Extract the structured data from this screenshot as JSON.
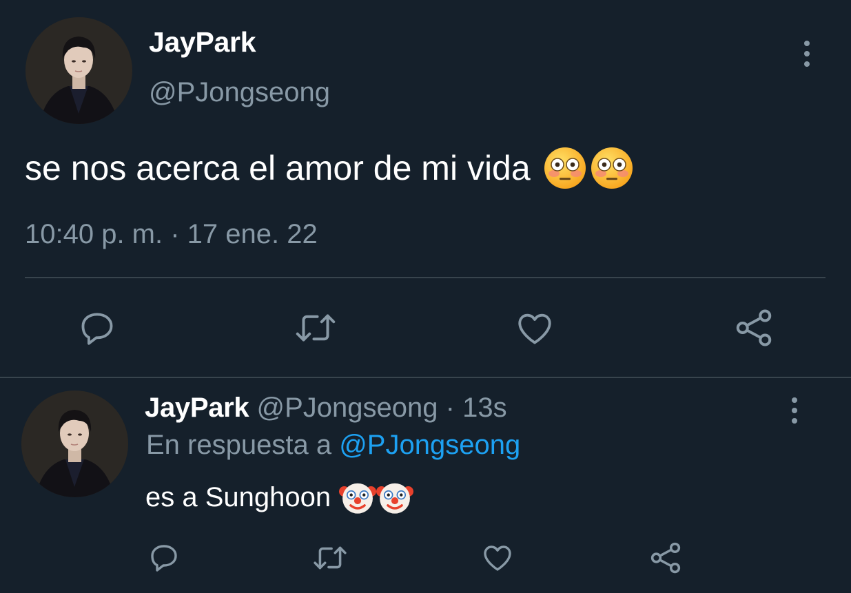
{
  "main_tweet": {
    "author_name": "JayPark",
    "handle": "@PJongseong",
    "text": "se nos acerca el amor de mi vida",
    "emojis": [
      "flushed-face-emoji",
      "flushed-face-emoji"
    ],
    "timestamp": "10:40 p. m. · 17 ene. 22",
    "actions": [
      "reply-icon",
      "retweet-icon",
      "like-icon",
      "share-icon"
    ],
    "menu_icon": "more-vertical-icon"
  },
  "reply_tweet": {
    "author_name": "JayPark",
    "handle": "@PJongseong",
    "separator": "·",
    "age": "13s",
    "reply_prefix": "En respuesta a",
    "reply_mention": "@PJongseong",
    "text": "es a Sunghoon",
    "emojis": [
      "clown-face-emoji",
      "clown-face-emoji"
    ],
    "actions": [
      "reply-icon",
      "retweet-icon",
      "like-icon",
      "share-icon"
    ],
    "menu_icon": "more-vertical-icon"
  },
  "colors": {
    "background": "#15202b",
    "primary_text": "#ffffff",
    "secondary_text": "#8899a6",
    "divider": "#38444d",
    "link": "#1da1f2"
  }
}
